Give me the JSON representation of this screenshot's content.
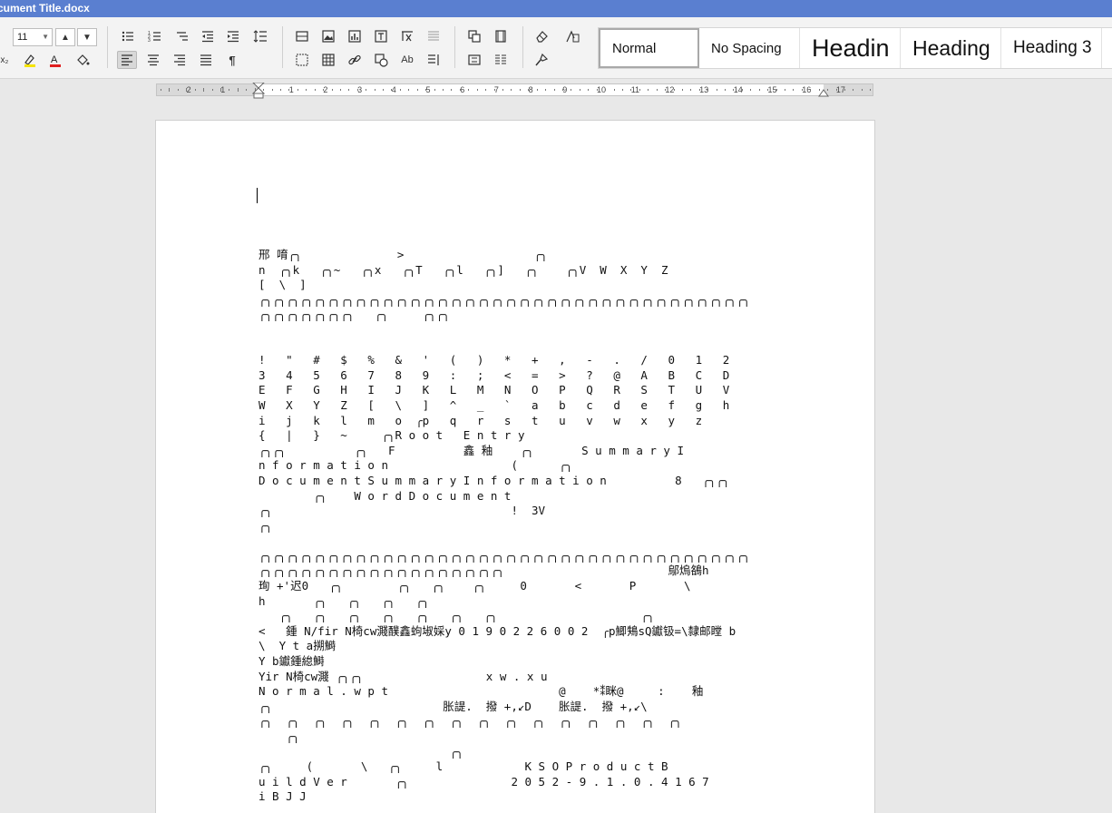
{
  "window": {
    "title": "cument Title.docx"
  },
  "ribbon": {
    "font_size": "11",
    "styles": [
      "Normal",
      "No Spacing",
      "Headin",
      "Heading",
      "Heading 3"
    ]
  },
  "ruler": {
    "labels": [
      "2",
      "1",
      "1",
      "2",
      "3",
      "4",
      "5",
      "6",
      "7",
      "8",
      "9",
      "10",
      "11",
      "12",
      "13",
      "14",
      "15",
      "16",
      "17"
    ]
  },
  "document": {
    "lines": [
      "邢 唷╭╮              >                   ╭╮",
      "n  ╭╮k   ╭╮~   ╭╮x   ╭╮T   ╭╮l   ╭╮]   ╭╮    ╭╮V  W  X  Y  Z",
      "[  \\  ]",
      "╭╮╭╮╭╮╭╮╭╮╭╮╭╮╭╮╭╮╭╮╭╮╭╮╭╮╭╮╭╮╭╮╭╮╭╮╭╮╭╮╭╮╭╮╭╮╭╮╭╮╭╮╭╮╭╮╭╮╭╮╭╮╭╮╭╮╭╮╭╮╭╮",
      "╭╮╭╮╭╮╭╮╭╮╭╮╭╮   ╭╮     ╭╮╭╮",
      "",
      "",
      "!   \"   #   $   %   &   '   (   )   *   +   ,   -   .   /   0   1   2",
      "3   4   5   6   7   8   9   :   ;   <   =   >   ?   @   A   B   C   D",
      "E   F   G   H   I   J   K   L   M   N   O   P   Q   R   S   T   U   V",
      "W   X   Y   Z   [   \\   ]   ^   _   `   a   b   c   d   e   f   g   h",
      "i   j   k   l   m   o  ╭p   q   r   s   t   u   v   w   x   y   z",
      "{   |   }   ~     ╭╮R o o t   E n t r y",
      "╭╮╭╮          ╭╮   F          鑫 釉    ╭╮       S u m m a r y I",
      "n f o r m a t i o n                  (      ╭╮",
      "D o c u m e n t S u m m a r y I n f o r m a t i o n          8   ╭╮╭╮",
      "        ╭╮    W o r d D o c u m e n t",
      "╭╮                                   !  3V",
      "╭╮",
      "",
      "╭╮╭╮╭╮╭╮╭╮╭╮╭╮╭╮╭╮╭╮╭╮╭╮╭╮╭╮╭╮╭╮╭╮╭╮╭╮╭╮╭╮╭╮╭╮╭╮╭╮╭╮╭╮╭╮╭╮╭╮╭╮╭╮╭╮╭╮╭╮╭╮",
      "╭╮╭╮╭╮╭╮╭╮╭╮╭╮╭╮╭╮╭╮╭╮╭╮╭╮╭╮╭╮╭╮╭╮╭╮                        鄔熓鵅h",
      "珣 +'迟0   ╭╮        ╭╮   ╭╮    ╭╮     0       <       P       \\",
      "h       ╭╮   ╭╮   ╭╮   ╭╮",
      "   ╭╮   ╭╮   ╭╮   ╭╮   ╭╮   ╭╮   ╭╮                     ╭╮",
      "<   鍾 N/fir N椅cw濺醭鑫蚼埱婇y 0 1 9 0 2 2 6 0 0 2  ╭p鯽鴩sQ钀钑=\\隸邮瞠 b",
      "\\  Y t a搠鰣",
      "Y b钀鍾緿鰣",
      "Yir N椅cw濺 ╭╮╭╮                  x w . x u",
      "N o r m a l . w p t                         @    *⁑眯@     :    釉",
      "╭╮                         胀諟.  撥 +,↙D    胀諟.  撥 +,↙\\",
      "╭╮  ╭╮  ╭╮  ╭╮  ╭╮  ╭╮  ╭╮  ╭╮  ╭╮  ╭╮  ╭╮  ╭╮  ╭╮  ╭╮  ╭╮  ╭╮",
      "    ╭╮",
      "                            ╭╮",
      "╭╮     (       \\   ╭╮     l            K S O P r o d u c t B",
      "u i l d V e r       ╭╮               2 0 5 2 - 9 . 1 . 0 . 4 1 6 7",
      "i B J J"
    ]
  }
}
